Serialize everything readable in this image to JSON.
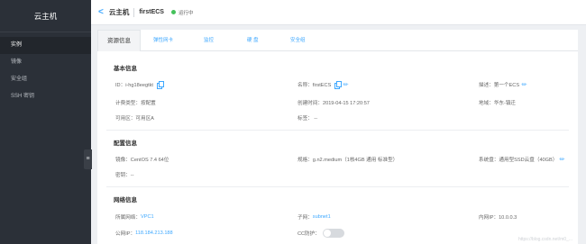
{
  "sidebar": {
    "title": "云主机",
    "items": [
      {
        "label": "实例"
      },
      {
        "label": "镜像"
      },
      {
        "label": "安全组"
      },
      {
        "label": "SSH 密钥"
      }
    ],
    "collapse_glyph": "≡"
  },
  "header": {
    "back_glyph": "<",
    "title": "云主机",
    "instance_name": "firstECS",
    "status": "运行中",
    "status_color": "#44c15b"
  },
  "tabs": [
    {
      "label": "资源信息"
    },
    {
      "label": "弹性网卡"
    },
    {
      "label": "监控"
    },
    {
      "label": "硬 盘"
    },
    {
      "label": "安全组"
    }
  ],
  "basic": {
    "title": "基本信息",
    "id": "ID：i-hg18eegtkt",
    "name": "名称：firstECS",
    "desc": "描述：第一个ECS",
    "billing": "计费类型：按配置",
    "created": "创建时间：2019-04-15 17:20:57",
    "region": "地域：华东-镇迁",
    "zone": "可用区：可用区A",
    "tags": "标签：  --"
  },
  "config": {
    "title": "配置信息",
    "image": "镜像：CentOS 7.4 64位",
    "spec": "规格：g.n2.medium（1核4GB 通用 标准型）",
    "sysdisk": "系统盘：通用型SSD云盘（40GB）",
    "password": "密钥：--"
  },
  "network": {
    "title": "网络信息",
    "vpc_label": "所属网络：",
    "vpc": "VPC1",
    "subnet_label": "子网：",
    "subnet": "subnet1",
    "private_ip": "内网IP：10.0.0.3",
    "public_label": "公网IP：",
    "public_ip": "118.184.213.188",
    "cc_label": "CC防护："
  },
  "watermark": "https://blog.csdn.net/m0_...",
  "colors": {
    "accent": "#3ea8ff",
    "sidebar_bg": "#2b3038",
    "status_green": "#44c15b"
  }
}
